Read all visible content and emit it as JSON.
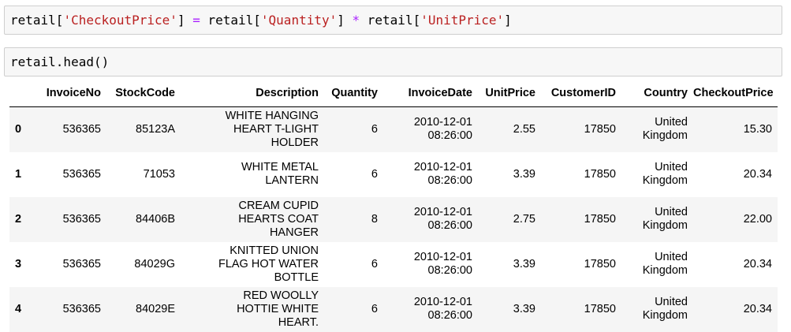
{
  "cells": [
    {
      "tokens": [
        {
          "text": "retail[",
          "kind": "plain"
        },
        {
          "text": "'CheckoutPrice'",
          "kind": "str"
        },
        {
          "text": "] ",
          "kind": "plain"
        },
        {
          "text": "=",
          "kind": "op"
        },
        {
          "text": " retail[",
          "kind": "plain"
        },
        {
          "text": "'Quantity'",
          "kind": "str"
        },
        {
          "text": "] ",
          "kind": "plain"
        },
        {
          "text": "*",
          "kind": "op"
        },
        {
          "text": " retail[",
          "kind": "plain"
        },
        {
          "text": "'UnitPrice'",
          "kind": "str"
        },
        {
          "text": "]",
          "kind": "plain"
        }
      ]
    },
    {
      "tokens": [
        {
          "text": "retail.head()",
          "kind": "plain"
        }
      ]
    }
  ],
  "table": {
    "columns": [
      "",
      "InvoiceNo",
      "StockCode",
      "Description",
      "Quantity",
      "InvoiceDate",
      "UnitPrice",
      "CustomerID",
      "Country",
      "CheckoutPrice"
    ],
    "rows": [
      {
        "index": "0",
        "InvoiceNo": "536365",
        "StockCode": "85123A",
        "Description": "WHITE HANGING HEART T-LIGHT HOLDER",
        "Quantity": "6",
        "InvoiceDate": "2010-12-01 08:26:00",
        "UnitPrice": "2.55",
        "CustomerID": "17850",
        "Country": "United Kingdom",
        "CheckoutPrice": "15.30"
      },
      {
        "index": "1",
        "InvoiceNo": "536365",
        "StockCode": "71053",
        "Description": "WHITE METAL LANTERN",
        "Quantity": "6",
        "InvoiceDate": "2010-12-01 08:26:00",
        "UnitPrice": "3.39",
        "CustomerID": "17850",
        "Country": "United Kingdom",
        "CheckoutPrice": "20.34"
      },
      {
        "index": "2",
        "InvoiceNo": "536365",
        "StockCode": "84406B",
        "Description": "CREAM CUPID HEARTS COAT HANGER",
        "Quantity": "8",
        "InvoiceDate": "2010-12-01 08:26:00",
        "UnitPrice": "2.75",
        "CustomerID": "17850",
        "Country": "United Kingdom",
        "CheckoutPrice": "22.00"
      },
      {
        "index": "3",
        "InvoiceNo": "536365",
        "StockCode": "84029G",
        "Description": "KNITTED UNION FLAG HOT WATER BOTTLE",
        "Quantity": "6",
        "InvoiceDate": "2010-12-01 08:26:00",
        "UnitPrice": "3.39",
        "CustomerID": "17850",
        "Country": "United Kingdom",
        "CheckoutPrice": "20.34"
      },
      {
        "index": "4",
        "InvoiceNo": "536365",
        "StockCode": "84029E",
        "Description": "RED WOOLLY HOTTIE WHITE HEART.",
        "Quantity": "6",
        "InvoiceDate": "2010-12-01 08:26:00",
        "UnitPrice": "3.39",
        "CustomerID": "17850",
        "Country": "United Kingdom",
        "CheckoutPrice": "20.34"
      }
    ]
  },
  "colors": {
    "string": "#ba2121",
    "operator": "#aa22ff",
    "cell_background": "#f7f7f7",
    "cell_border": "#cfcfcf",
    "stripe": "#f5f5f5"
  }
}
